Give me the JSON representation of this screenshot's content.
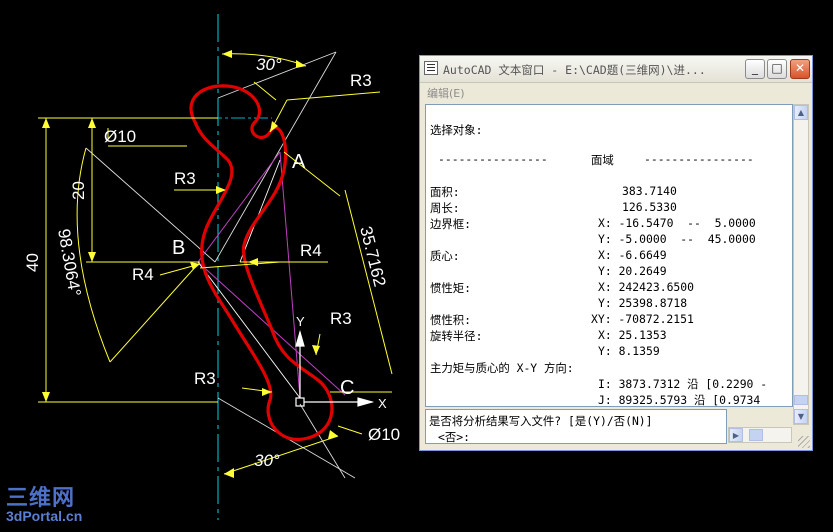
{
  "drawing": {
    "labels": {
      "angle_top": "30°",
      "angle_bottom": "30°",
      "r3_top_right": "R3",
      "r3_left": "R3",
      "r3_right": "R3",
      "r3_bottom_left": "R3",
      "r4_left": "R4",
      "r4_right": "R4",
      "dia_top": "Ø10",
      "dia_bottom": "Ø10",
      "dim_20": "20",
      "dim_40": "40",
      "dim_angle_arc": "98.3064°",
      "dim_length": "35.7162",
      "point_a": "A",
      "point_b": "B",
      "point_c": "C",
      "axis_x": "X",
      "axis_y": "Y"
    },
    "colors": {
      "profile": "#e00000",
      "dimension": "#ffff33",
      "center_line": "#00b0c0",
      "construction": "#c040c0"
    }
  },
  "text_window": {
    "title": "AutoCAD 文本窗口 - E:\\CAD题(三维网)\\进...",
    "buttons": {
      "minimize": "_",
      "maximize": "□",
      "close": "✕"
    },
    "menu": {
      "edit": "编辑(E)"
    },
    "lines": {
      "select": "选择对象:",
      "dash_left": "----------------",
      "region": "面域",
      "dash_right": "----------------",
      "area_label": "面积:",
      "area_value": "383.7140",
      "perimeter_label": "周长:",
      "perimeter_value": "126.5330",
      "bbox_label": "边界框:",
      "bbox_x": "X: -16.5470  --  5.0000",
      "bbox_y": "Y: -5.0000  --  45.0000",
      "centroid_label": "质心:",
      "centroid_x": "X: -6.6649",
      "centroid_y": "Y: 20.2649",
      "inertia_label": "惯性矩:",
      "inertia_x": "X: 242423.6500",
      "inertia_y": "Y: 25398.8718",
      "product_label": "惯性积:",
      "product_xy": "XY: -70872.2151",
      "radii_label": "旋转半径:",
      "radii_x": "X: 25.1353",
      "radii_y": "Y: 8.1359",
      "principal_label": "主力矩与质心的 X-Y 方向:",
      "principal_i": "I: 3873.7312 沿 [0.2290 -",
      "principal_j": "J: 89325.5793 沿 [0.9734"
    },
    "command": {
      "prompt": "是否将分析结果写入文件? [是(Y)/否(N)]",
      "default": "<否>:"
    }
  },
  "watermark": {
    "name": "三维网",
    "url": "3dPortal.cn"
  }
}
